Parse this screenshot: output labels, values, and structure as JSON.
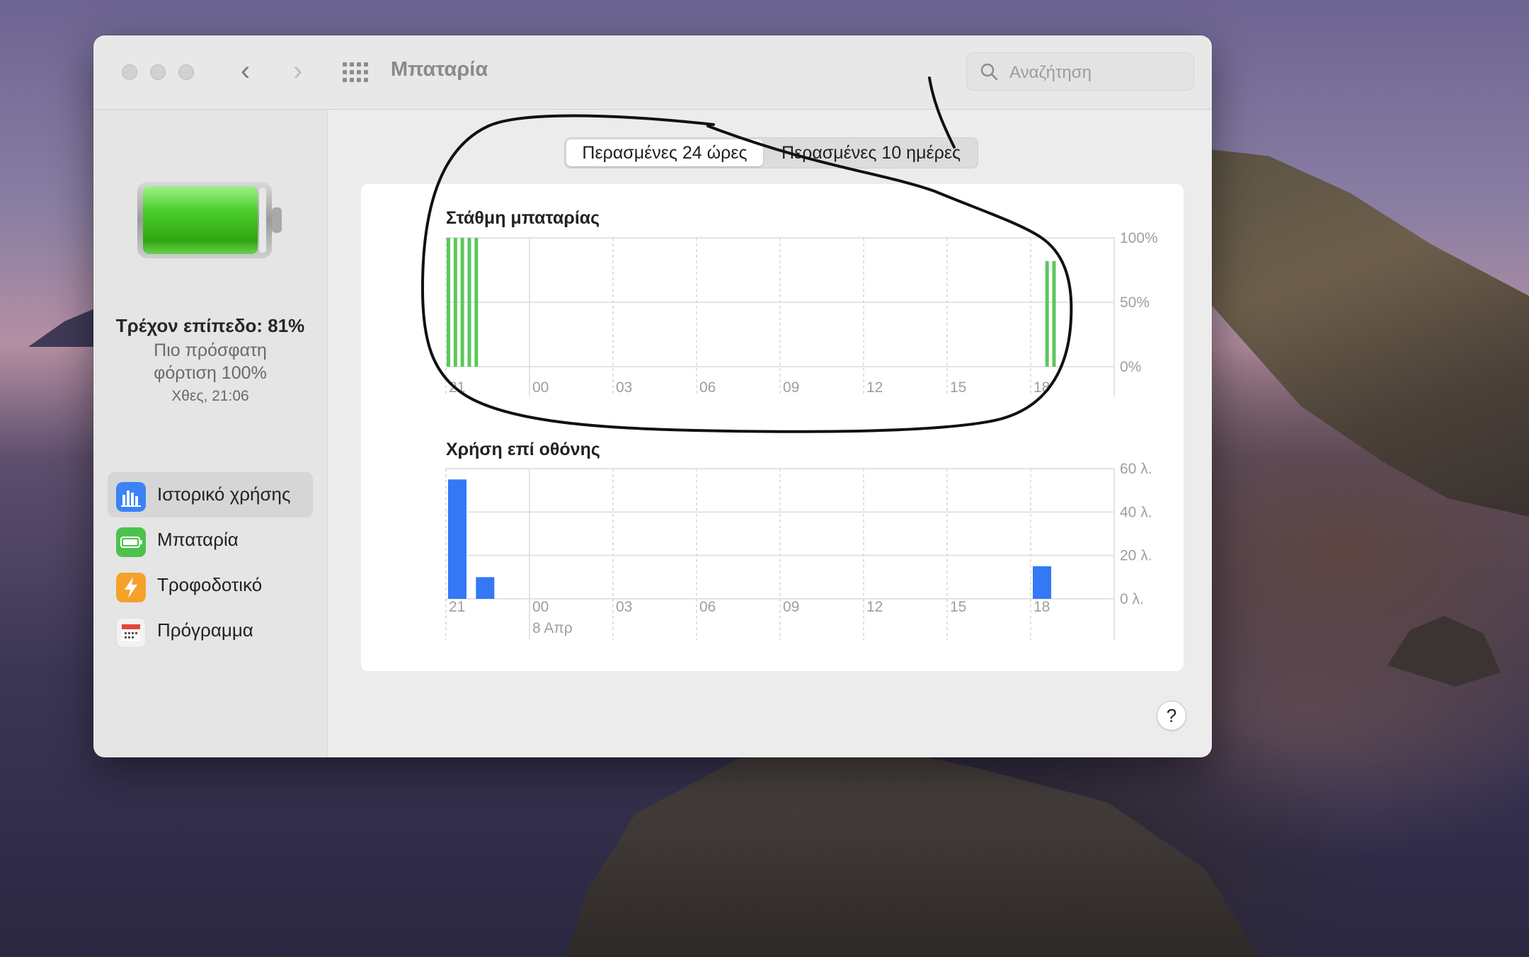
{
  "window": {
    "title": "Μπαταρία",
    "search_placeholder": "Αναζήτηση"
  },
  "sidebar": {
    "current_level": "Τρέχον επίπεδο: 81%",
    "last_charge_line1": "Πιο πρόσφατη",
    "last_charge_line2": "φόρτιση 100%",
    "last_charge_time": "Χθες, 21:06",
    "items": [
      {
        "label": "Ιστορικό χρήσης",
        "icon": "usage-history-icon",
        "active": true
      },
      {
        "label": "Μπαταρία",
        "icon": "battery-icon",
        "active": false
      },
      {
        "label": "Τροφοδοτικό",
        "icon": "power-adapter-icon",
        "active": false
      },
      {
        "label": "Πρόγραμμα",
        "icon": "schedule-icon",
        "active": false
      }
    ]
  },
  "tabs": {
    "last_24h": "Περασμένες 24 ώρες",
    "last_10d": "Περασμένες 10 ημέρες"
  },
  "colors": {
    "battery_green": "#5ac85a",
    "usage_blue": "#3478f6"
  },
  "chart_data": [
    {
      "type": "bar",
      "title": "Στάθμη μπαταρίας",
      "x_ticks": [
        "21",
        "00",
        "03",
        "06",
        "09",
        "12",
        "15",
        "18"
      ],
      "y_ticks": [
        "100%",
        "50%",
        "0%"
      ],
      "ylim": [
        0,
        100
      ],
      "grid": true,
      "bars": [
        {
          "hour": 21.0,
          "value": 100
        },
        {
          "hour": 21.25,
          "value": 100
        },
        {
          "hour": 21.5,
          "value": 100
        },
        {
          "hour": 21.75,
          "value": 100
        },
        {
          "hour": 22.0,
          "value": 100
        },
        {
          "hour": 42.5,
          "value": 82
        },
        {
          "hour": 42.75,
          "value": 82
        }
      ]
    },
    {
      "type": "bar",
      "title": "Χρήση επί οθόνης",
      "x_ticks": [
        "21",
        "00",
        "03",
        "06",
        "09",
        "12",
        "15",
        "18"
      ],
      "x_sublabel": "8 Απρ",
      "y_ticks": [
        "60 λ.",
        "40 λ.",
        "20 λ.",
        "0 λ."
      ],
      "ylim": [
        0,
        60
      ],
      "grid": true,
      "bars": [
        {
          "hour": 21,
          "value": 55
        },
        {
          "hour": 22,
          "value": 10
        },
        {
          "hour": 42,
          "value": 15
        }
      ]
    }
  ]
}
